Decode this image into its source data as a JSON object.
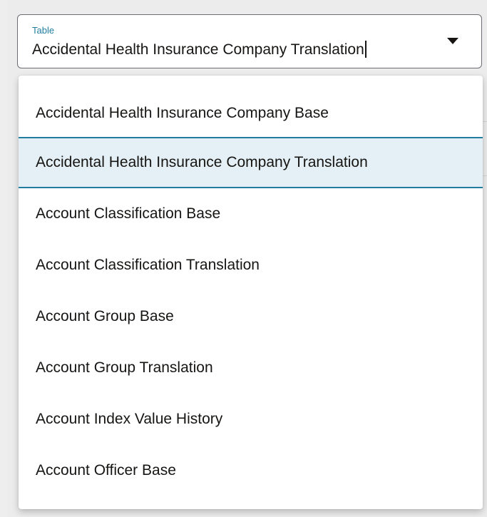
{
  "field": {
    "label": "Table",
    "value": "Accidental Health Insurance Company Translation",
    "dropdown_icon": "chevron-down-icon"
  },
  "options": [
    {
      "label": "Accidental Health Insurance Company Base",
      "selected": false
    },
    {
      "label": "Accidental Health Insurance Company Translation",
      "selected": true
    },
    {
      "label": "Account Classification Base",
      "selected": false
    },
    {
      "label": "Account Classification Translation",
      "selected": false
    },
    {
      "label": "Account Group Base",
      "selected": false
    },
    {
      "label": "Account Group Translation",
      "selected": false
    },
    {
      "label": "Account Index Value History",
      "selected": false
    },
    {
      "label": "Account Officer Base",
      "selected": false
    }
  ],
  "colors": {
    "accent": "#227e9e",
    "selected_bg": "#e4f0f5",
    "text": "#161513",
    "border": "#6f6b73"
  }
}
